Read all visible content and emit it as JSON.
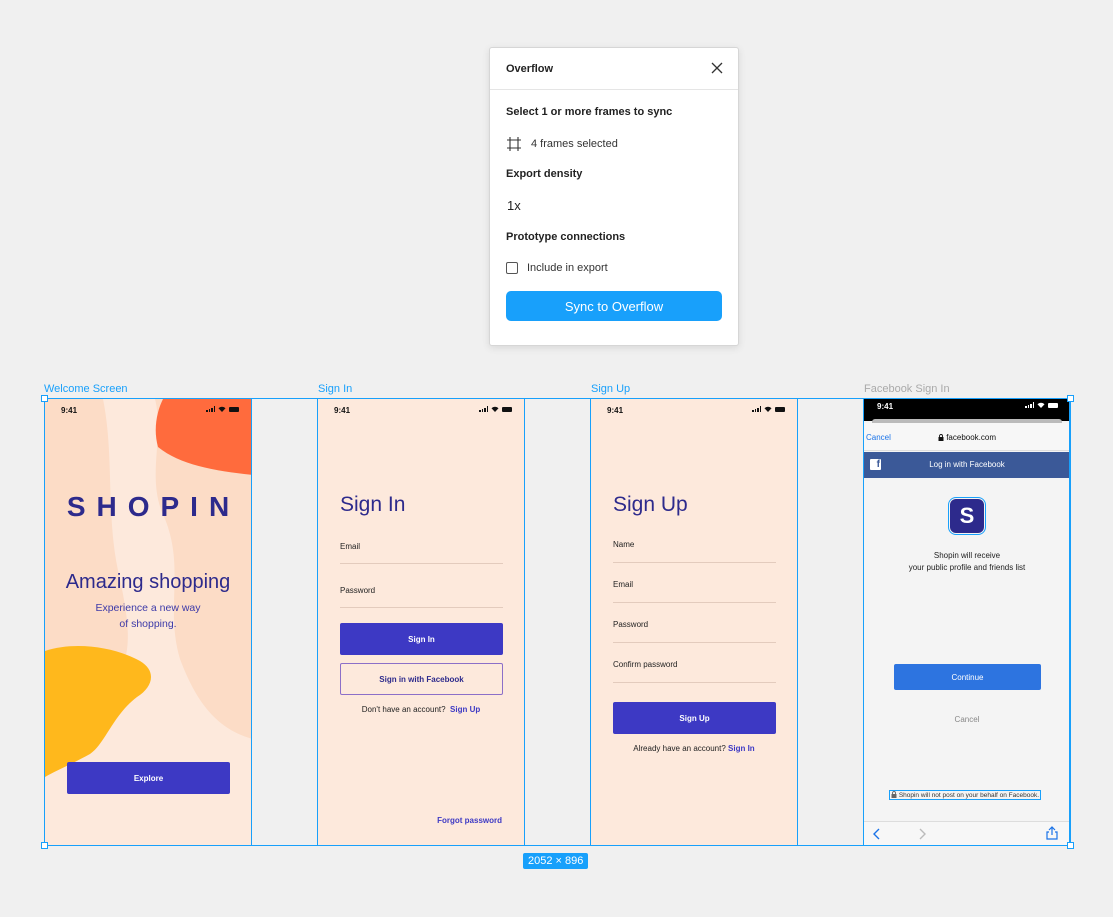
{
  "panel": {
    "title": "Overflow",
    "select_label": "Select 1 or more frames to sync",
    "frames_selected": "4 frames selected",
    "density_label": "Export density",
    "density_value": "1x",
    "prototype_label": "Prototype connections",
    "include_label": "Include in export",
    "include_checked": false,
    "sync_button": "Sync to Overflow"
  },
  "canvas": {
    "selection_size": "2052 × 896",
    "frame_labels": [
      "Welcome Screen",
      "Sign In",
      "Sign Up",
      "Facebook Sign In"
    ]
  },
  "status": {
    "time": "9:41"
  },
  "welcome": {
    "brand": "SHOPIN",
    "title": "Amazing shopping",
    "subtitle_1": "Experience a new way",
    "subtitle_2": "of shopping.",
    "explore": "Explore"
  },
  "signin": {
    "title": "Sign In",
    "email": "Email",
    "password": "Password",
    "signin_button": "Sign In",
    "facebook_button": "Sign in with Facebook",
    "no_account": "Don't have an account?",
    "signup_link": "Sign Up",
    "forgot": "Forgot password"
  },
  "signup": {
    "title": "Sign Up",
    "name": "Name",
    "email": "Email",
    "password": "Password",
    "confirm": "Confirm password",
    "signup_button": "Sign Up",
    "have_account": "Already have an account?",
    "signin_link": "Sign In"
  },
  "facebook": {
    "cancel": "Cancel",
    "url": "facebook.com",
    "bar_title": "Log in with Facebook",
    "app_letter": "S",
    "receive_1": "Shopin will receive",
    "receive_2": "your public profile and friends list",
    "continue": "Continue",
    "cancel_2": "Cancel",
    "note": "Shopin will not post on your behalf on Facebook."
  },
  "colors": {
    "accent": "#18a0fb",
    "brand": "#2d2a8c",
    "button": "#3d39c4",
    "frame_bg": "#fde9dc",
    "orange": "#ff6b3d",
    "yellow": "#ffb81c",
    "facebook": "#3b5998"
  }
}
